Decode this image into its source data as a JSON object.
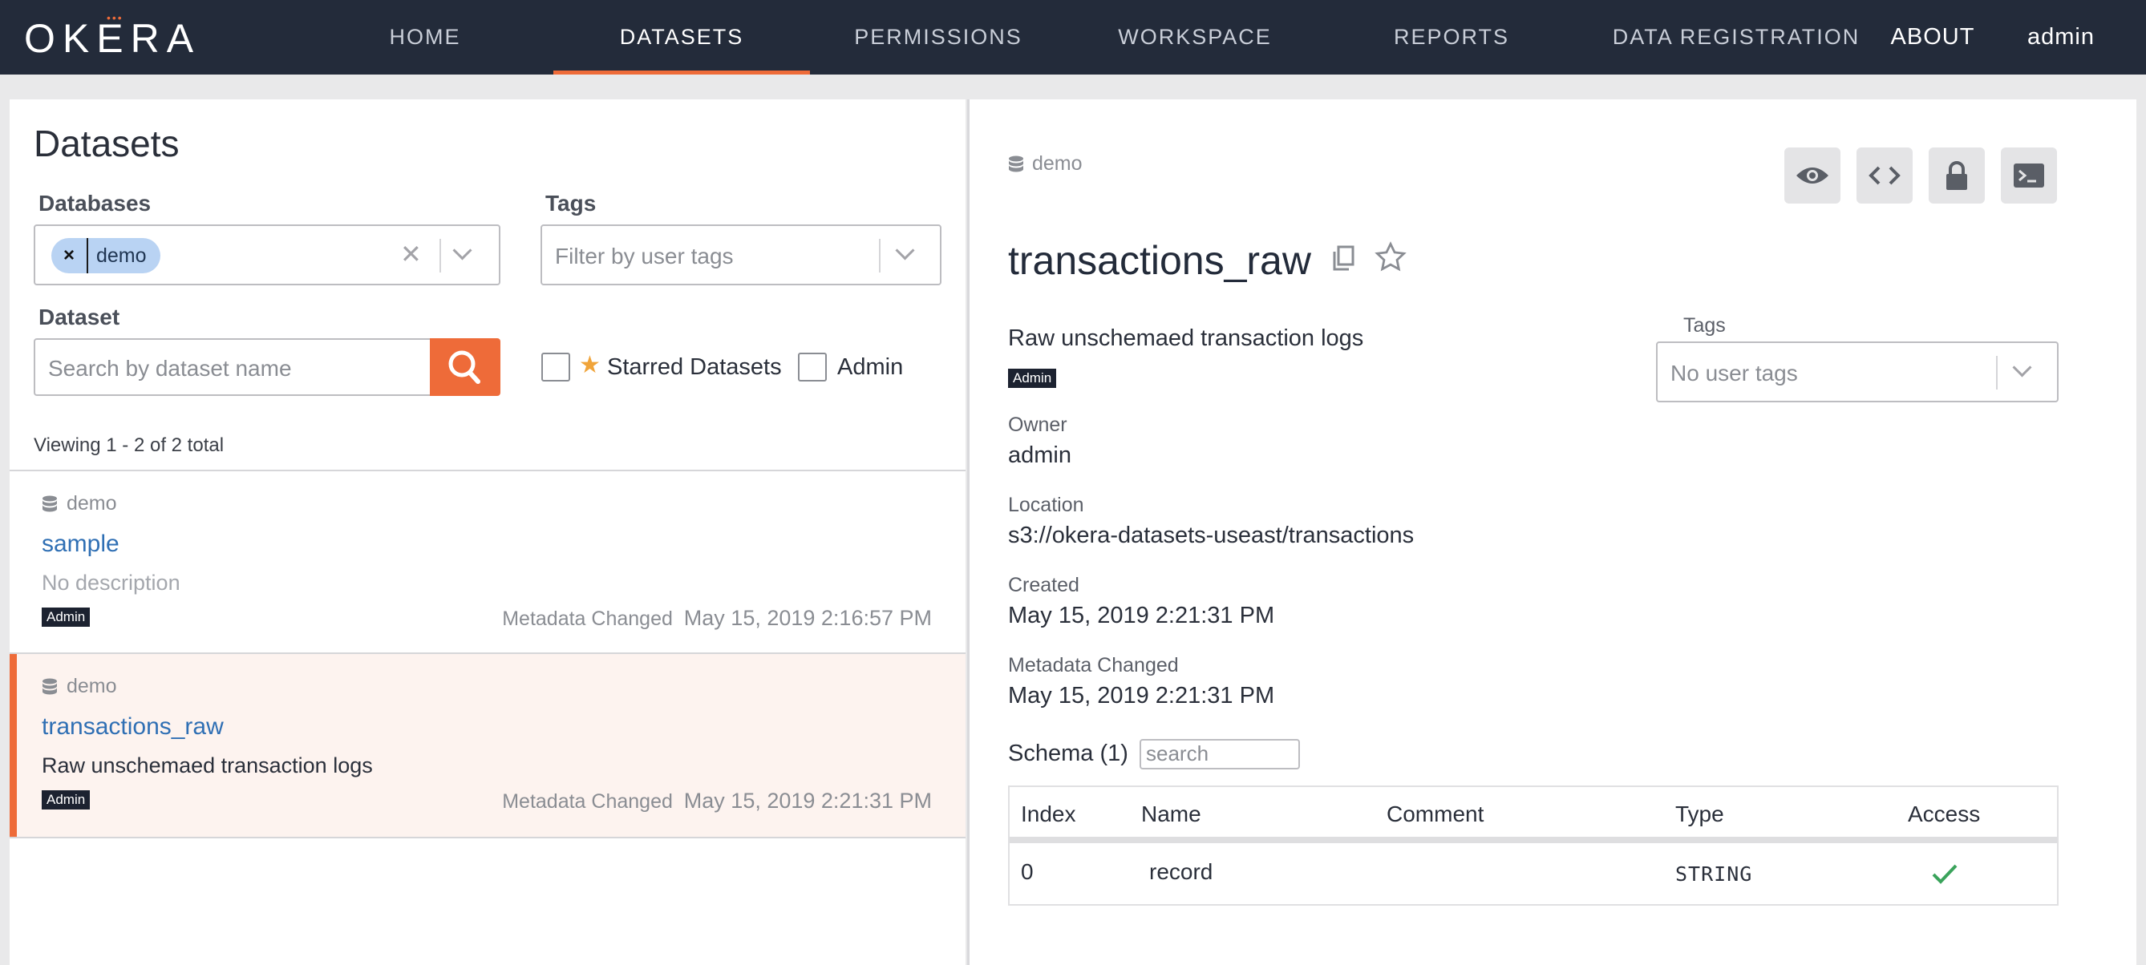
{
  "nav": {
    "logo": "OKERA",
    "items": [
      "HOME",
      "DATASETS",
      "PERMISSIONS",
      "WORKSPACE",
      "REPORTS",
      "DATA REGISTRATION"
    ],
    "about": "ABOUT",
    "user": "admin",
    "active": "DATASETS",
    "accent": "#ee6b39"
  },
  "filters": {
    "title": "Datasets",
    "databases_label": "Databases",
    "databases_selected": "demo",
    "tags_label": "Tags",
    "tags_placeholder": "Filter by user tags",
    "dataset_label": "Dataset",
    "dataset_placeholder": "Search by dataset name",
    "starred_label": "Starred Datasets",
    "admin_label": "Admin",
    "viewing": "Viewing 1 - 2 of 2 total"
  },
  "results": [
    {
      "db": "demo",
      "name": "sample",
      "description": "No description",
      "badge": "Admin",
      "meta_label": "Metadata Changed",
      "meta_value": "May 15, 2019 2:16:57 PM",
      "selected": false
    },
    {
      "db": "demo",
      "name": "transactions_raw",
      "description": "Raw unschemaed transaction logs",
      "badge": "Admin",
      "meta_label": "Metadata Changed",
      "meta_value": "May 15, 2019 2:21:31 PM",
      "selected": true
    }
  ],
  "detail": {
    "db": "demo",
    "title": "transactions_raw",
    "description": "Raw unschemaed transaction logs",
    "badge": "Admin",
    "tags_label": "Tags",
    "tags_placeholder": "No user tags",
    "owner_label": "Owner",
    "owner": "admin",
    "location_label": "Location",
    "location": "s3://okera-datasets-useast/transactions",
    "created_label": "Created",
    "created": "May 15, 2019 2:21:31 PM",
    "meta_label": "Metadata Changed",
    "meta_value": "May 15, 2019 2:21:31 PM",
    "schema_label": "Schema (1)",
    "schema_search_placeholder": "search",
    "schema_headers": [
      "Index",
      "Name",
      "Comment",
      "Type",
      "Access"
    ],
    "schema_rows": [
      {
        "index": "0",
        "name": "record",
        "comment": "",
        "type": "STRING",
        "access": "check-icon"
      }
    ]
  }
}
